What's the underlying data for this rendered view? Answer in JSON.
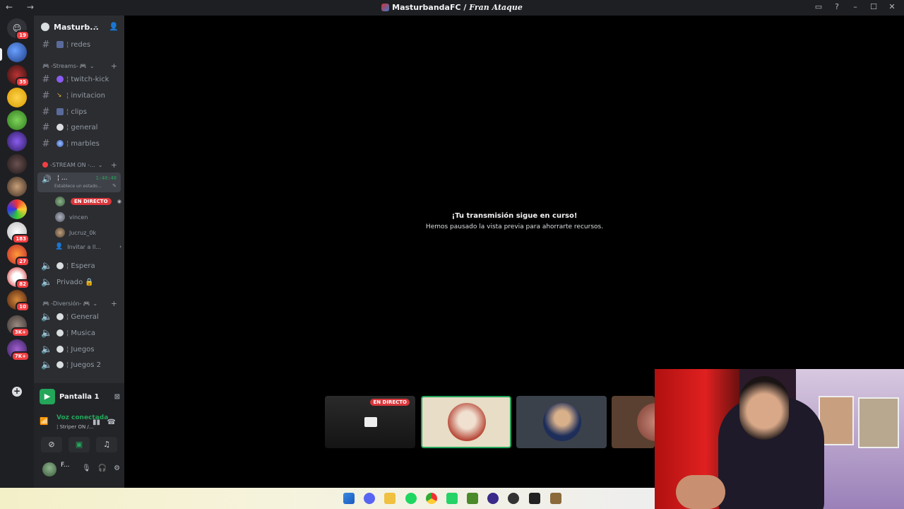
{
  "window": {
    "title_prefix": "MasturbandaFC / ",
    "title_channel": "Fran Ataque",
    "nav": "← →"
  },
  "rail": {
    "home_badge": "19",
    "servers": [
      {
        "name": "server-1",
        "badge": ""
      },
      {
        "name": "server-2",
        "badge": "35"
      },
      {
        "name": "server-3",
        "badge": ""
      },
      {
        "name": "server-4",
        "badge": ""
      },
      {
        "name": "server-5",
        "badge": ""
      },
      {
        "name": "server-6",
        "badge": ""
      },
      {
        "name": "server-7",
        "badge": ""
      },
      {
        "name": "server-8",
        "badge": ""
      },
      {
        "name": "server-9",
        "badge": "183"
      },
      {
        "name": "server-10",
        "badge": "27"
      },
      {
        "name": "server-11",
        "badge": "82"
      },
      {
        "name": "server-12",
        "badge": "10"
      },
      {
        "name": "server-13",
        "badge": "3K+"
      },
      {
        "name": "server-14",
        "badge": "7K+"
      }
    ]
  },
  "sidebar": {
    "server_name": "Masturb...",
    "channel_redes": "redes",
    "cat_streams": "-Streams-",
    "channels_streams": [
      "twitch-kick",
      "invitacion",
      "clips",
      "general",
      "marbles"
    ],
    "cat_stream_on": "-STREAM ON -...",
    "voice_active": {
      "label": "¦ ...",
      "time": "1:40:40",
      "status": "Establece un estado..."
    },
    "live_badge": "EN DIRECTO",
    "voice_users": [
      "vincen",
      "Jucruz_0k"
    ],
    "invite": "Invitar a ll...",
    "voice_channels_1": [
      "Espera",
      "Privado 🔒"
    ],
    "cat_diversion": "-Diversión-",
    "voice_channels_2": [
      "General",
      "Musica",
      "Juegos",
      "Juegos 2"
    ]
  },
  "userpanel": {
    "screen_share": "Pantalla 1",
    "voice_connected": "Voz conectada",
    "voice_channel": "¦ Striper ON /...",
    "user": "F..."
  },
  "stage": {
    "heading": "¡Tu transmisión sigue en curso!",
    "subtext": "Hemos pausado la vista previa para ahorrarte recursos.",
    "live_badge": "EN DIRECTO"
  },
  "colors": {
    "live": "#da373c",
    "connected": "#23a55a",
    "rail_bg": "#1e1f22",
    "sidebar_bg": "#2b2d31"
  }
}
